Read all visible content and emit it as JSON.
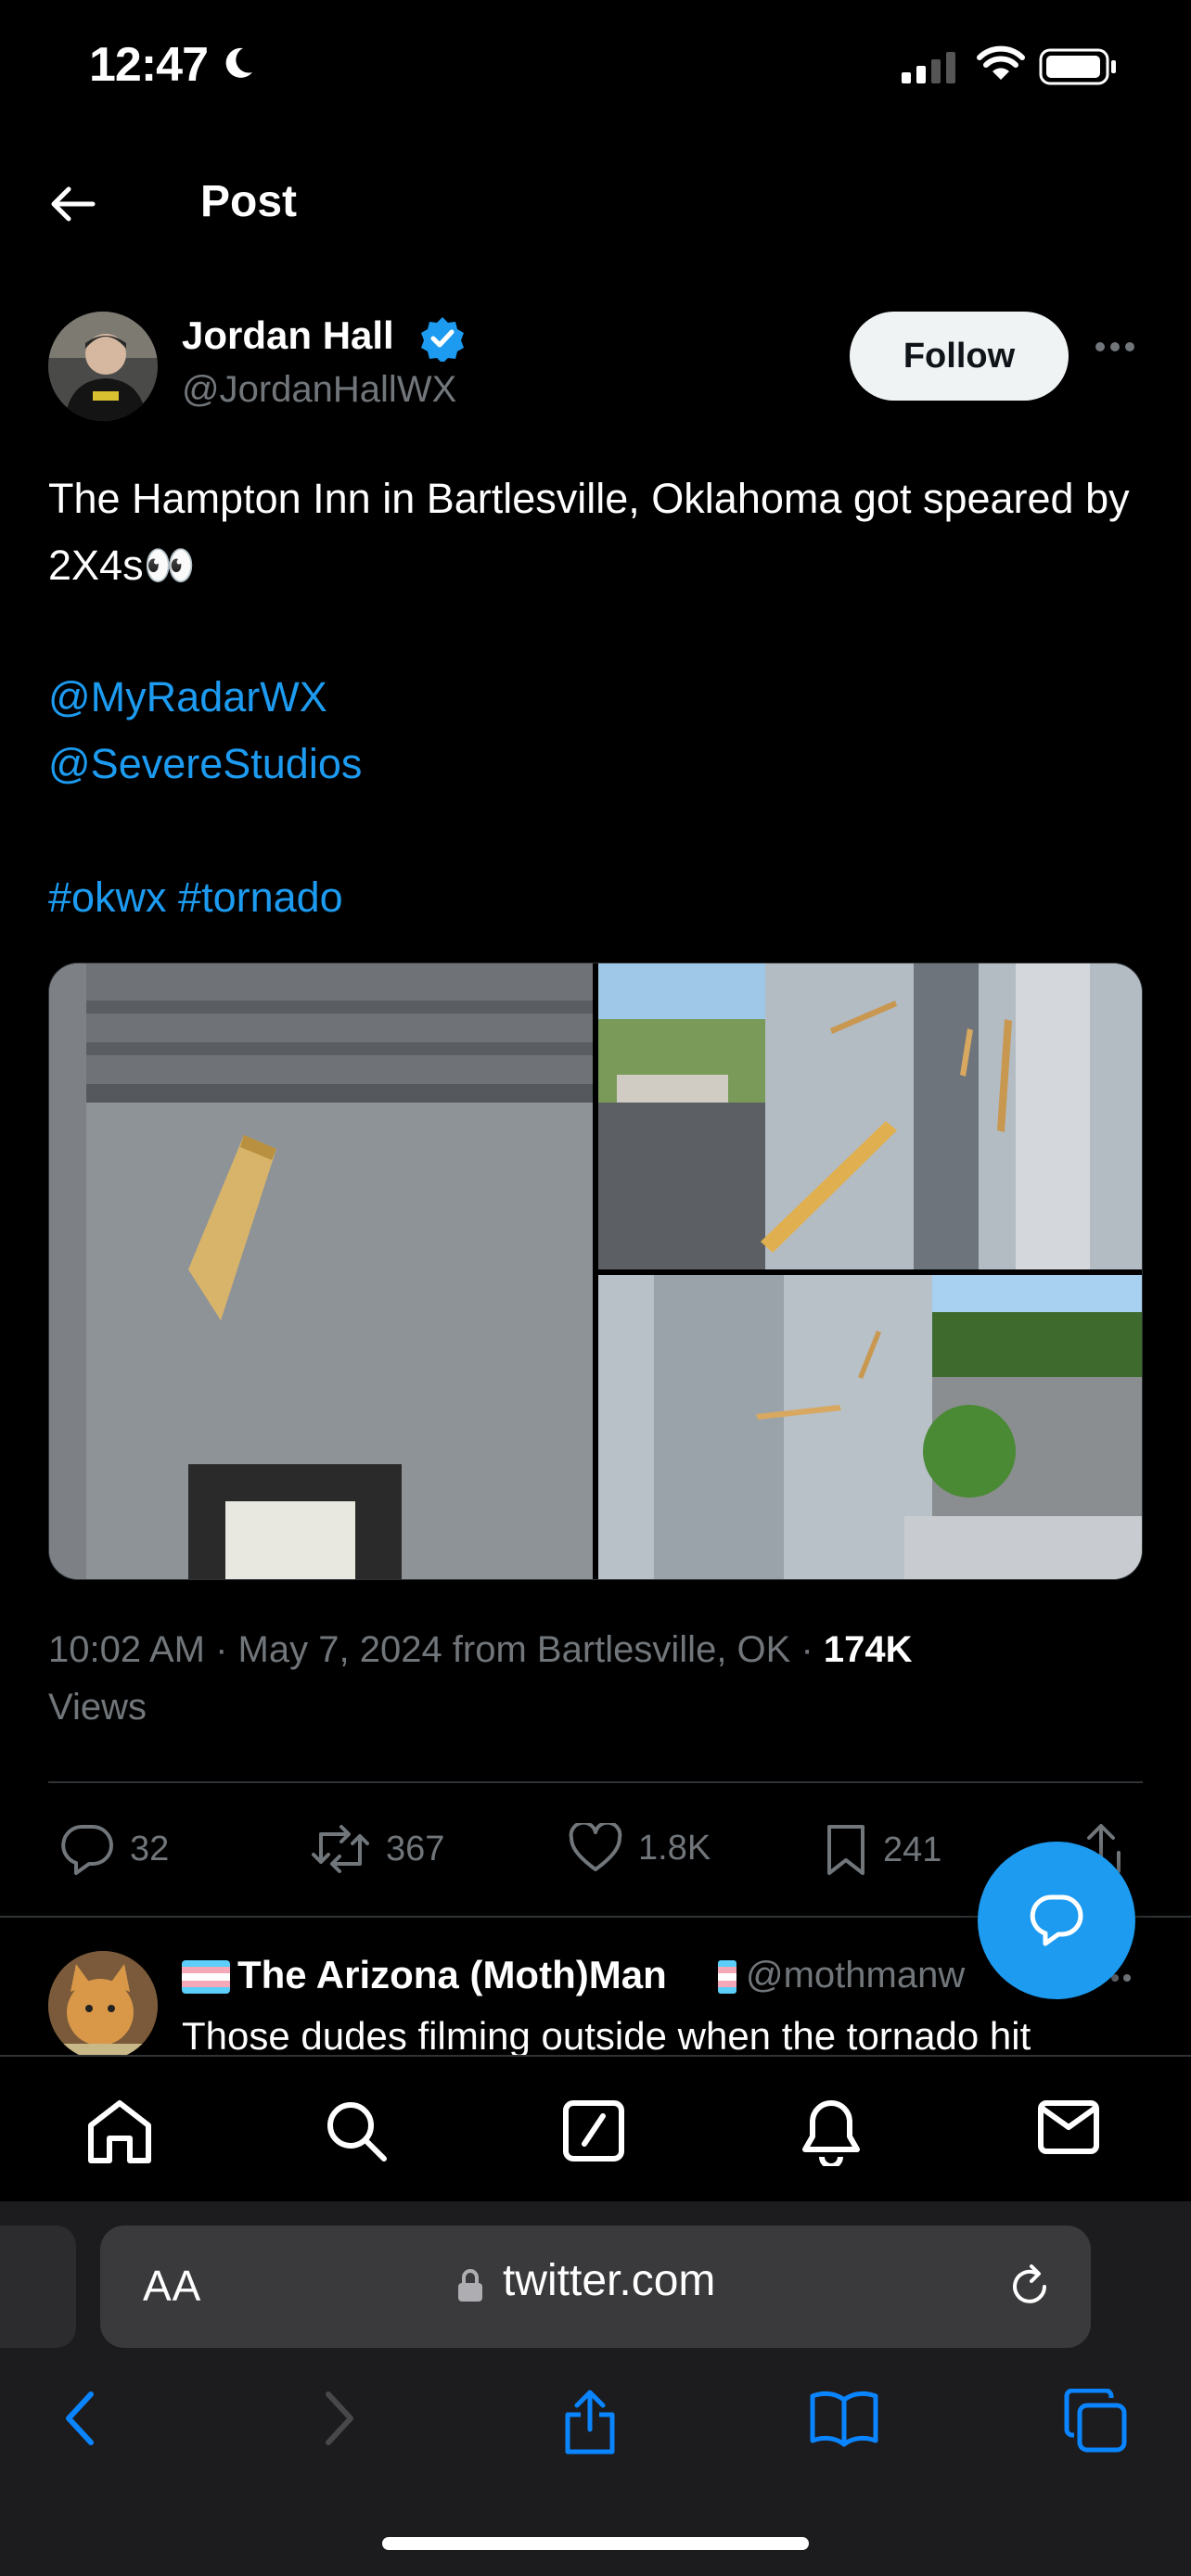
{
  "status_bar": {
    "time": "12:47"
  },
  "header": {
    "title": "Post"
  },
  "tweet": {
    "author_name": "Jordan Hall",
    "author_handle": "@JordanHallWX",
    "follow_label": "Follow",
    "text": "The Hampton Inn in Bartlesville, Oklahoma got speared by 2X4s👀",
    "mentions": [
      "@MyRadarWX",
      "@SevereStudios"
    ],
    "hashtags": "#okwx #tornado",
    "meta_prefix": "10:02 AM · May 7, 2024 from Bartlesville, OK · ",
    "views_count": "174K",
    "views_label": "Views",
    "reply_count": "32",
    "retweet_count": "367",
    "like_count": "1.8K",
    "bookmark_count": "241"
  },
  "reply": {
    "name": "The Arizona (Moth)Man",
    "handle": "@mothmanw",
    "text": "Those dudes filming outside when the tornado hit"
  },
  "browser": {
    "aa_label": "AA",
    "url": "twitter.com"
  },
  "icons": {
    "nav": [
      "home-icon",
      "search-icon",
      "compose-icon",
      "bell-icon",
      "mail-icon"
    ],
    "actions": [
      "reply-icon",
      "retweet-icon",
      "like-icon",
      "bookmark-icon",
      "share-icon"
    ]
  },
  "colors": {
    "accent": "#1d9bf0",
    "muted": "#71767b",
    "background": "#000000"
  }
}
